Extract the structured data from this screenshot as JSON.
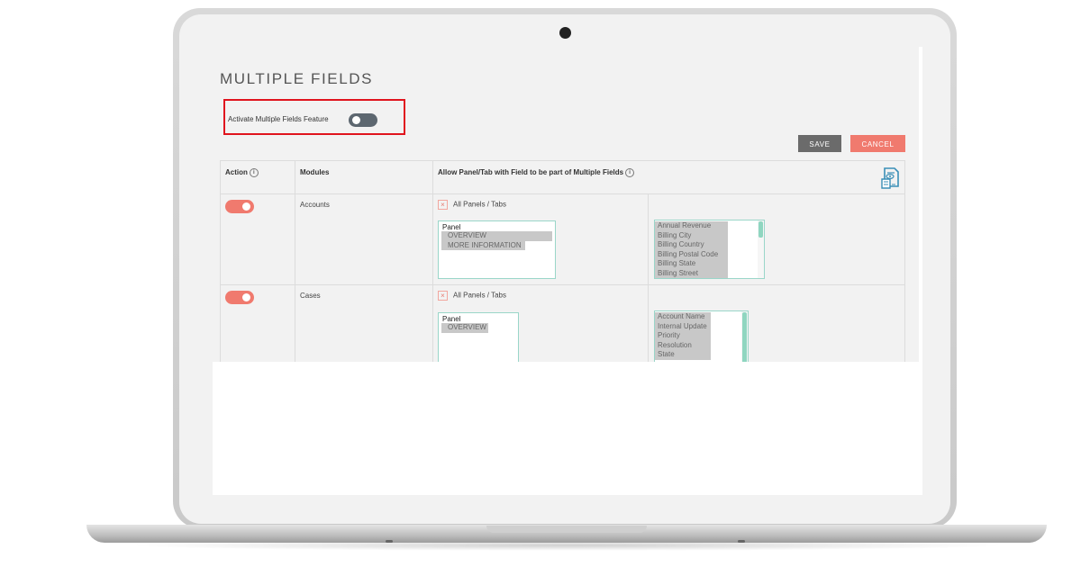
{
  "page": {
    "title": "MULTIPLE FIELDS",
    "feature_label": "Activate Multiple Fields Feature",
    "feature_active": false
  },
  "toolbar": {
    "save_label": "SAVE",
    "cancel_label": "CANCEL"
  },
  "table": {
    "headers": {
      "action": "Action",
      "modules": "Modules",
      "allow": "Allow Panel/Tab with Field to be part of Multiple Fields"
    },
    "rows": [
      {
        "module": "Accounts",
        "enabled": true,
        "all_panels_label": "All Panels / Tabs",
        "panel_header": "Panel",
        "panels": [
          "OVERVIEW",
          "MORE INFORMATION"
        ],
        "fields": [
          "Annual Revenue",
          "Billing City",
          "Billing Country",
          "Billing Postal Code",
          "Billing State",
          "Billing Street"
        ]
      },
      {
        "module": "Cases",
        "enabled": true,
        "all_panels_label": "All Panels / Tabs",
        "panel_header": "Panel",
        "panels": [
          "OVERVIEW"
        ],
        "fields": [
          "Account Name",
          "Internal Update",
          "Priority",
          "Resolution",
          "State"
        ]
      }
    ]
  },
  "colors": {
    "accent": "#f07a6e",
    "highlight": "#e0141e",
    "save": "#6b6b6b",
    "list_border": "#9ad6c9"
  },
  "icons": {
    "info": "info-circle-icon",
    "remove": "close-icon",
    "document": "document-preview-icon"
  }
}
